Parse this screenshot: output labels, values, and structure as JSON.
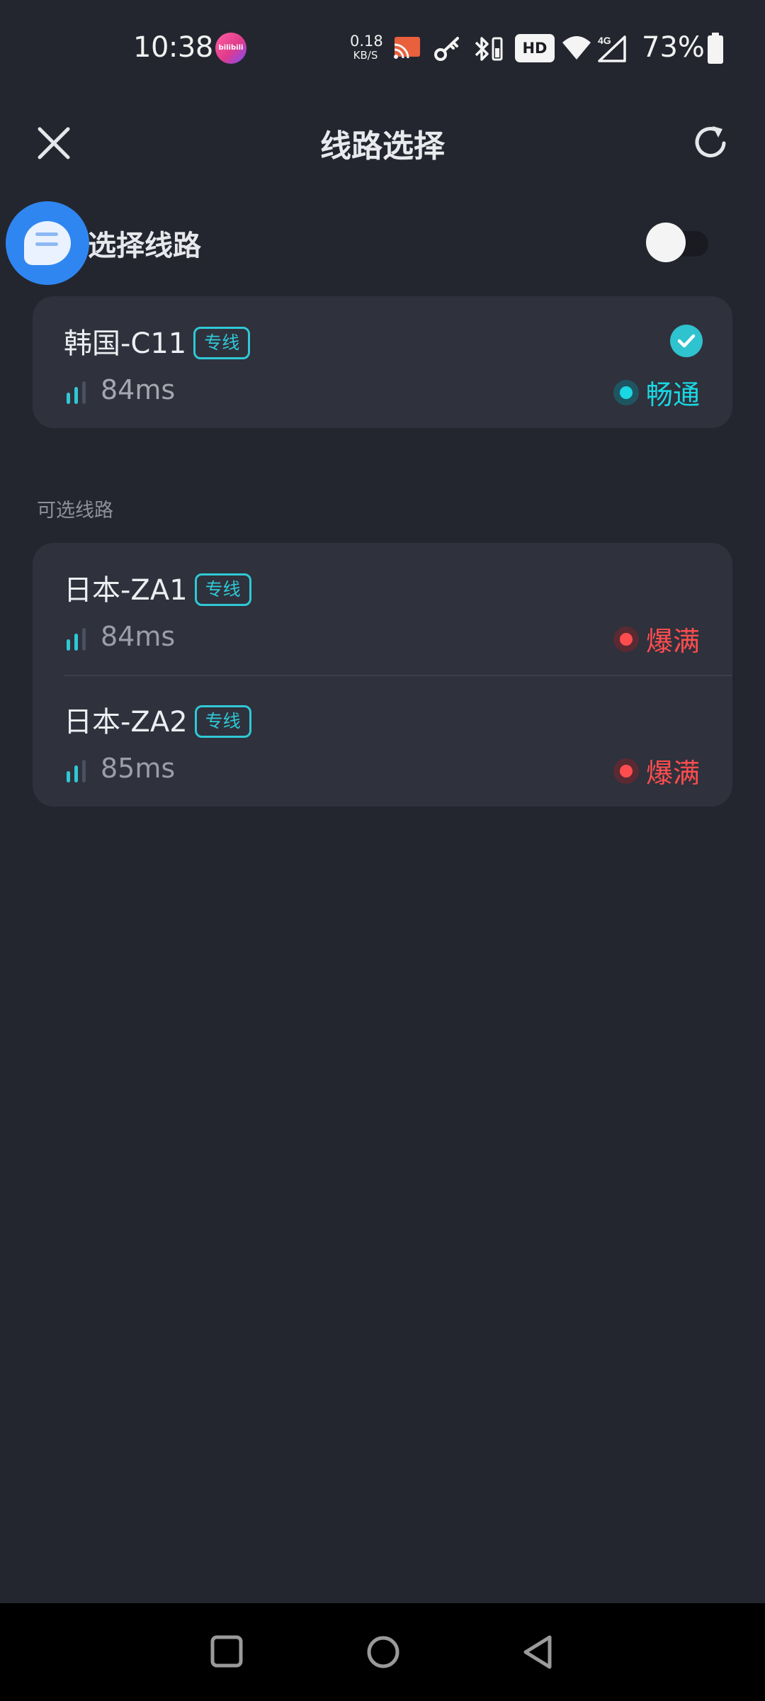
{
  "status_bar": {
    "time": "10:38",
    "app_badge": "bilibili",
    "net_speed_value": "0.18",
    "net_speed_unit": "KB/S",
    "hd": "HD",
    "network_type": "4G",
    "battery": "73%"
  },
  "header": {
    "title": "线路选择"
  },
  "auto_select": {
    "label": "选择线路",
    "enabled": false
  },
  "current_route": {
    "name": "韩国-C11",
    "tag": "专线",
    "latency": "84ms",
    "status": "畅通",
    "selected": true
  },
  "available_section": {
    "label": "可选线路",
    "routes": [
      {
        "name": "日本-ZA1",
        "tag": "专线",
        "latency": "84ms",
        "status": "爆满"
      },
      {
        "name": "日本-ZA2",
        "tag": "专线",
        "latency": "85ms",
        "status": "爆满"
      }
    ]
  },
  "colors": {
    "background": "#24262f",
    "card": "#2f313c",
    "accent_cyan": "#2fc9d6",
    "status_smooth": "#19d7e3",
    "status_full": "#ff4d4f",
    "floating_bubble": "#2f86f0"
  },
  "icons": {
    "close": "close-icon",
    "refresh": "refresh-icon",
    "check": "check-icon",
    "signal": "signal-bars-icon",
    "nav_recent": "square-icon",
    "nav_home": "circle-icon",
    "nav_back": "triangle-back-icon"
  }
}
